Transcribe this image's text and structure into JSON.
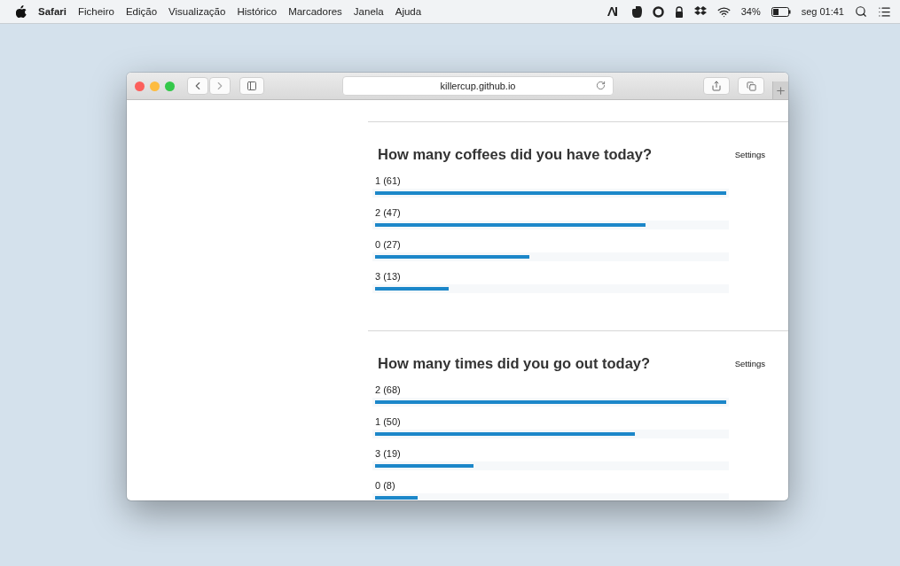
{
  "menu_bar": {
    "app_name": "Safari",
    "items": [
      "Ficheiro",
      "Edição",
      "Visualização",
      "Histórico",
      "Marcadores",
      "Janela",
      "Ajuda"
    ],
    "battery": "34%",
    "clock": "seg 01:41"
  },
  "browser": {
    "url": "killercup.github.io"
  },
  "polls": [
    {
      "question": "How many coffees did you have today?",
      "settings": "Settings",
      "options": [
        {
          "label": "1 (61)",
          "level": 1
        },
        {
          "label": "2 (47)",
          "level": 0.77
        },
        {
          "label": "0 (27)",
          "level": 0.44
        },
        {
          "label": "3 (13)",
          "level": 0.21
        }
      ]
    },
    {
      "question": "How many times did you go out today?",
      "settings": "Settings",
      "options": [
        {
          "label": "2 (68)",
          "level": 1
        },
        {
          "label": "1 (50)",
          "level": 0.74
        },
        {
          "label": "3 (19)",
          "level": 0.28
        },
        {
          "label": "0 (8)",
          "level": 0.12
        }
      ]
    }
  ]
}
